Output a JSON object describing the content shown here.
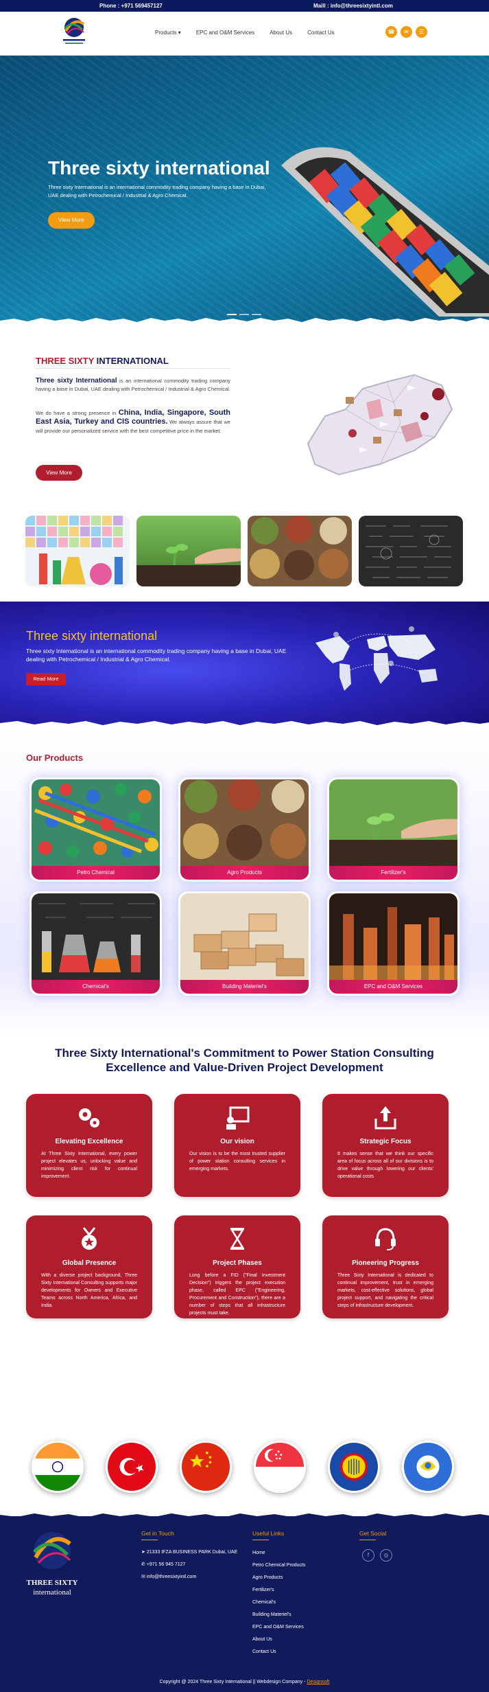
{
  "topbar": {
    "phone": "Phone : +971 569457127",
    "mail": "Maill : info@threesixtyintl.com"
  },
  "header": {
    "nav": [
      "Products ▾",
      "EPC and O&M Services",
      "About Us",
      "Contact Us"
    ],
    "icons": [
      "phone-icon",
      "mail-icon",
      "menu-icon"
    ]
  },
  "hero": {
    "title": "Three sixty international",
    "text": "Three sixty International is an international commodity trading company having a base in Dubai, UAE dealing with Petrochemical / Industrial & Agro Chemical.",
    "button": "View More"
  },
  "about": {
    "title_red": "THREE SIXTY",
    "title_blue": " INTERNATIONAL",
    "p1_bold": "Three sixty International",
    "p1": " is an international commodity trading company having a base in Dubai, UAE dealing with Petrochemical / Industrial & Agro Chemical.",
    "p2_pre": "We do have a strong presence in ",
    "p2_bold": "China, India, Singapore, South East Asia, Turkey and CIS countries.",
    "p2_post": " We always assure that we will provide our personalized service with the best competitive price in the market.",
    "button": "View More"
  },
  "banner": {
    "title": "Three sixty international",
    "text": "Three sixty International is an international commodity trading company having a base in Dubai, UAE dealing with Petrochemical / Industrial & Agro Chemical.",
    "button": "Read More"
  },
  "products": {
    "title": "Our Products",
    "items": [
      "Petro Chemical",
      "Agro Products",
      "Fertilizer's",
      "Chemical's",
      "Building Materiel's",
      "EPC and O&M Services"
    ]
  },
  "commitment": {
    "title": "Three Sixty International's Commitment to Power Station Consulting Excellence and Value-Driven Project Development",
    "cards": [
      {
        "title": "Elevating Excellence",
        "icon": "gears-icon",
        "text": "At Three Sixty International, every power project elevates us, unlocking value and minimizing client risk for continual improvement."
      },
      {
        "title": "Our vision",
        "icon": "presentation-icon",
        "text": "Our vision is to be the most trusted supplier of power station consulting services in emerging markets."
      },
      {
        "title": "Strategic Focus",
        "icon": "upload-tray-icon",
        "text": "It makes sense that we think our specific area of focus across all of our divisions is to drive value through lowering our clients' operational costs"
      },
      {
        "title": "Global Presence",
        "icon": "medal-icon",
        "text": "With a diverse project background, Three Sixty International Consulting supports major developments for Owners and Executive Teams across North America, Africa, and India."
      },
      {
        "title": "Project Phases",
        "icon": "hourglass-icon",
        "text": "Long before a FID (\"Final Investment Decision\") triggers the project execution phase, called EPC (\"Engineering, Procurement and Construction\"), there are a number of steps that all infrastructure projects must take."
      },
      {
        "title": "Pioneering Progress",
        "icon": "headset-icon",
        "text": "Three Sixty International is dedicated to continual improvement, trust in emerging markets, cost-effective solutions, global project support, and navigating the critical steps of infrastructure development."
      }
    ]
  },
  "flags": [
    "india-flag",
    "turkey-flag",
    "china-flag",
    "singapore-flag",
    "asean-flag",
    "cis-flag"
  ],
  "footer": {
    "logo_line1": "THREE SIXTY",
    "logo_line2": "international",
    "git_title": "Get in Touch",
    "address": "21333 IFZA BUSINESS PARK Dubai, UAE",
    "phone": "+971 56 945 7127",
    "email": "info@threesixtyintl.com",
    "links_title": "Useful Links",
    "links": [
      "Home",
      "Petro Chemical Products",
      "Agro Products",
      "Fertilizer's",
      "Chemical's",
      "Building Materiel's",
      "EPC and O&M Services",
      "About Us",
      "Contact Us"
    ],
    "social_title": "Get Social",
    "copyright": "Copyright @ 2024 Three Sixty International || Webdesign Company - ",
    "designer": "Designsoft"
  },
  "colors": {
    "navy": "#111b5c",
    "red": "#b01e2e",
    "orange": "#f39c12",
    "pink": "#e91e63"
  }
}
